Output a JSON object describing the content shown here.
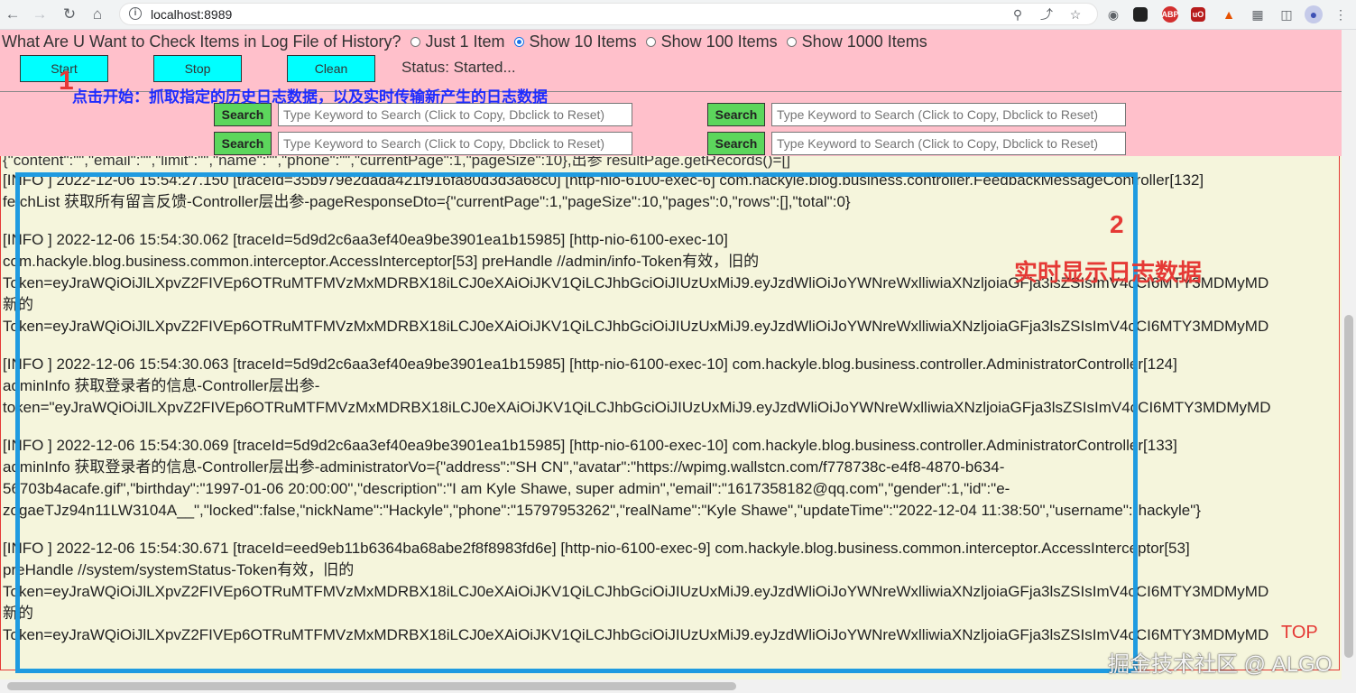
{
  "browser": {
    "url": "localhost:8989"
  },
  "controls": {
    "question": "What Are U Want to Check Items in Log File of History?",
    "radio_options": [
      "Just 1 Item",
      "Show 10 Items",
      "Show 100 Items",
      "Show 1000 Items"
    ],
    "selected_index": 1,
    "start_label": "Start",
    "stop_label": "Stop",
    "clean_label": "Clean",
    "status_text": "Status: Started..."
  },
  "search": {
    "button_label": "Search",
    "placeholder": "Type Keyword to Search (Click to Copy, Dbclick to Reset)"
  },
  "annotations": {
    "one_number": "1",
    "one_text": "点击开始：抓取指定的历史日志数据，以及实时传输新产生的日志数据",
    "two_number": "2",
    "two_text": "实时显示日志数据",
    "top": "TOP",
    "watermark": "掘金技术社区 @ ALGO"
  },
  "log": {
    "partial_line": "{\"content\":\"\",\"email\":\"\",\"limit\":\"\",\"name\":\"\",\"phone\":\"\",\"currentPage\":1,\"pageSize\":10},出参 resultPage.getRecords()=[]",
    "entries": [
      {
        "lines": [
          "[INFO ] 2022-12-06 15:54:27.150 [traceId=35b979e2dada421f916fa80d3d3a68c0] [http-nio-6100-exec-6] com.hackyle.blog.business.controller.FeedbackMessageController[132]",
          "fetchList 获取所有留言反馈-Controller层出参-pageResponseDto={\"currentPage\":1,\"pageSize\":10,\"pages\":0,\"rows\":[],\"total\":0}"
        ]
      },
      {
        "lines": [
          "[INFO ] 2022-12-06 15:54:30.062 [traceId=5d9d2c6aa3ef40ea9be3901ea1b15985] [http-nio-6100-exec-10]",
          "com.hackyle.blog.business.common.interceptor.AccessInterceptor[53] preHandle //admin/info-Token有效，旧的",
          "Token=eyJraWQiOiJlLXpvZ2FIVEp6OTRuMTFMVzMxMDRBX18iLCJ0eXAiOiJKV1QiLCJhbGciOiJIUzUxMiJ9.eyJzdWliOiJoYWNreWxlliwiaXNzljoiaGFja3lsZSIsImV4cCI6MTY3MDMyMD",
          "新的",
          "Token=eyJraWQiOiJlLXpvZ2FIVEp6OTRuMTFMVzMxMDRBX18iLCJ0eXAiOiJKV1QiLCJhbGciOiJIUzUxMiJ9.eyJzdWliOiJoYWNreWxlliwiaXNzljoiaGFja3lsZSIsImV4cCI6MTY3MDMyMD"
        ]
      },
      {
        "lines": [
          "[INFO ] 2022-12-06 15:54:30.063 [traceId=5d9d2c6aa3ef40ea9be3901ea1b15985] [http-nio-6100-exec-10] com.hackyle.blog.business.controller.AdministratorController[124]",
          "adminInfo 获取登录者的信息-Controller层出参-",
          "token=\"eyJraWQiOiJlLXpvZ2FIVEp6OTRuMTFMVzMxMDRBX18iLCJ0eXAiOiJKV1QiLCJhbGciOiJIUzUxMiJ9.eyJzdWliOiJoYWNreWxlliwiaXNzljoiaGFja3lsZSIsImV4cCI6MTY3MDMyMD"
        ]
      },
      {
        "lines": [
          "[INFO ] 2022-12-06 15:54:30.069 [traceId=5d9d2c6aa3ef40ea9be3901ea1b15985] [http-nio-6100-exec-10] com.hackyle.blog.business.controller.AdministratorController[133]",
          "adminInfo 获取登录者的信息-Controller层出参-administratorVo={\"address\":\"SH CN\",\"avatar\":\"https://wpimg.wallstcn.com/f778738c-e4f8-4870-b634-",
          "56703b4acafe.gif\",\"birthday\":\"1997-01-06 20:00:00\",\"description\":\"I am Kyle Shawe, super admin\",\"email\":\"1617358182@qq.com\",\"gender\":1,\"id\":\"e-",
          "zogaeTJz94n11LW3104A__\",\"locked\":false,\"nickName\":\"Hackyle\",\"phone\":\"15797953262\",\"realName\":\"Kyle Shawe\",\"updateTime\":\"2022-12-04 11:38:50\",\"username\":\"hackyle\"}"
        ]
      },
      {
        "lines": [
          "[INFO ] 2022-12-06 15:54:30.671 [traceId=eed9eb11b6364ba68abe2f8f8983fd6e] [http-nio-6100-exec-9] com.hackyle.blog.business.common.interceptor.AccessInterceptor[53]",
          "preHandle //system/systemStatus-Token有效，旧的",
          "Token=eyJraWQiOiJlLXpvZ2FIVEp6OTRuMTFMVzMxMDRBX18iLCJ0eXAiOiJKV1QiLCJhbGciOiJIUzUxMiJ9.eyJzdWliOiJoYWNreWxlliwiaXNzljoiaGFja3lsZSIsImV4cCI6MTY3MDMyMD",
          "新的",
          "Token=eyJraWQiOiJlLXpvZ2FIVEp6OTRuMTFMVzMxMDRBX18iLCJ0eXAiOiJKV1QiLCJhbGciOiJIUzUxMiJ9.eyJzdWliOiJoYWNreWxlliwiaXNzljoiaGFja3lsZSIsImV4cCI6MTY3MDMyMD"
        ]
      }
    ]
  }
}
